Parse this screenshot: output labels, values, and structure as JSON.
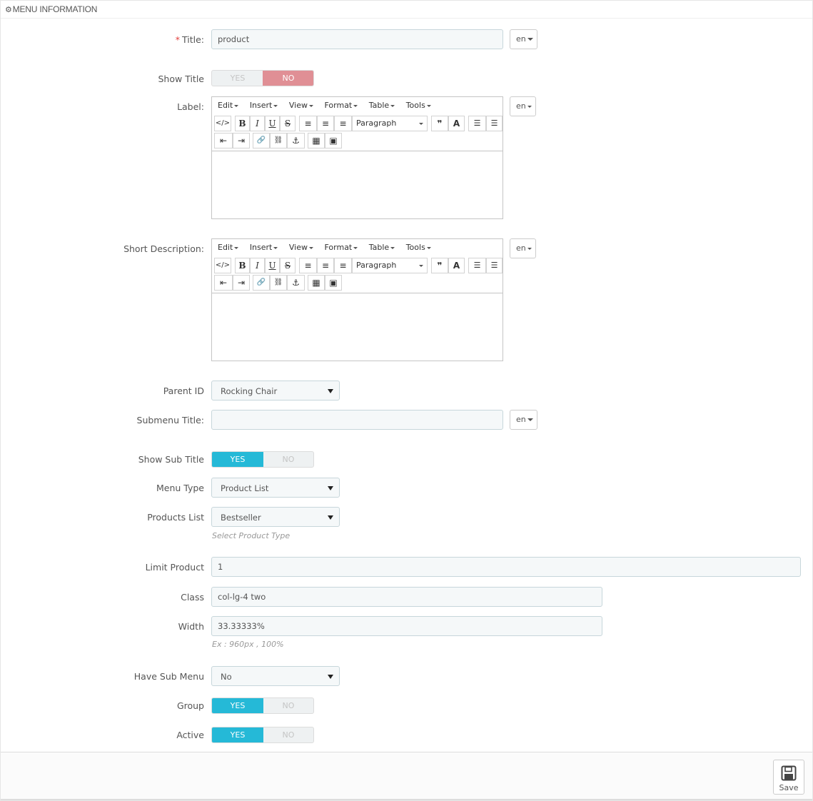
{
  "panel": {
    "heading": "MENU INFORMATION",
    "heading_icon": "cogs-icon"
  },
  "fields": {
    "title": {
      "label": "Title:",
      "required_mark": "*",
      "value": "product",
      "lang": "en"
    },
    "show_title": {
      "label": "Show Title",
      "yes": "YES",
      "no": "NO",
      "selected": "NO"
    },
    "label": {
      "label": "Label:",
      "lang": "en"
    },
    "short_description": {
      "label": "Short Description:",
      "lang": "en"
    },
    "parent_id": {
      "label": "Parent ID",
      "value": "Rocking Chair"
    },
    "submenu_title": {
      "label": "Submenu Title:",
      "value": "",
      "lang": "en"
    },
    "show_sub_title": {
      "label": "Show Sub Title",
      "yes": "YES",
      "no": "NO",
      "selected": "YES"
    },
    "menu_type": {
      "label": "Menu Type",
      "value": "Product List"
    },
    "products_list": {
      "label": "Products List",
      "value": "Bestseller",
      "help": "Select Product Type"
    },
    "limit_product": {
      "label": "Limit Product",
      "value": "1"
    },
    "class": {
      "label": "Class",
      "value": "col-lg-4 two"
    },
    "width": {
      "label": "Width",
      "value": "33.33333%",
      "help": "Ex : 960px , 100%"
    },
    "have_sub_menu": {
      "label": "Have Sub Menu",
      "value": "No"
    },
    "group": {
      "label": "Group",
      "yes": "YES",
      "no": "NO",
      "selected": "YES"
    },
    "active": {
      "label": "Active",
      "yes": "YES",
      "no": "NO",
      "selected": "YES"
    }
  },
  "editor": {
    "menus": [
      "Edit",
      "Insert",
      "View",
      "Format",
      "Table",
      "Tools"
    ],
    "format_select": "Paragraph",
    "toolbar_buttons": [
      {
        "name": "source-code-icon",
        "glyph": "</>"
      },
      {
        "name": "bold-button",
        "glyph": "B"
      },
      {
        "name": "italic-button",
        "glyph": "I"
      },
      {
        "name": "underline-button",
        "glyph": "U"
      },
      {
        "name": "strikethrough-button",
        "glyph": "S"
      },
      {
        "name": "align-left-icon",
        "glyph": "≡"
      },
      {
        "name": "align-center-icon",
        "glyph": "≡"
      },
      {
        "name": "align-right-icon",
        "glyph": "≡"
      },
      {
        "name": "blockquote-icon",
        "glyph": "❞"
      },
      {
        "name": "text-color-icon",
        "glyph": "A"
      },
      {
        "name": "bullet-list-icon",
        "glyph": "☰"
      },
      {
        "name": "numbered-list-icon",
        "glyph": "☰"
      },
      {
        "name": "outdent-icon",
        "glyph": "⇤"
      },
      {
        "name": "indent-icon",
        "glyph": "⇥"
      },
      {
        "name": "link-icon",
        "glyph": "🔗"
      },
      {
        "name": "unlink-icon",
        "glyph": "⛓"
      },
      {
        "name": "anchor-icon",
        "glyph": "⚓"
      },
      {
        "name": "media-icon",
        "glyph": "▦"
      },
      {
        "name": "image-icon",
        "glyph": "▣"
      }
    ]
  },
  "footer": {
    "save_label": "Save",
    "save_icon": "floppy-disk-icon"
  },
  "colors": {
    "switch_yes_active": "#25b9d7",
    "switch_no_active": "#e08f95",
    "required": "#e3413e"
  }
}
